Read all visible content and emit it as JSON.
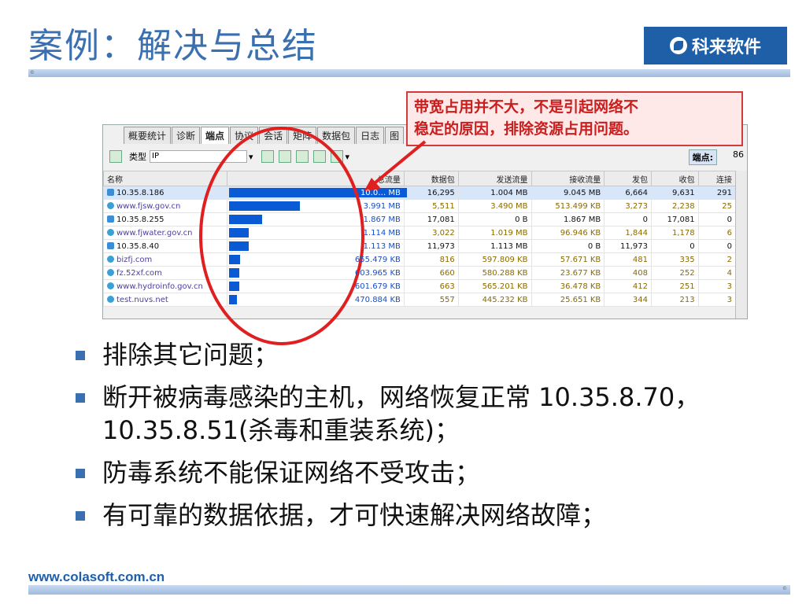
{
  "slide": {
    "title": "案例：解决与总结",
    "logo_text": "科来软件",
    "footer_url": "www.colasoft.com.cn"
  },
  "app": {
    "tabs": [
      "概要统计",
      "诊断",
      "端点",
      "协议",
      "会话",
      "矩阵",
      "数据包",
      "日志",
      "图"
    ],
    "active_tab": "端点",
    "toolbar": {
      "type_label": "类型",
      "type_value": "IP"
    },
    "endpoint_label": "端点:",
    "endpoint_value": "86",
    "columns": [
      "名称",
      "总流量",
      "数据包",
      "发送流量",
      "接收流量",
      "发包",
      "收包",
      "连接"
    ],
    "rows": [
      {
        "name": "10.35.8.186",
        "kind": "host",
        "total": "10.0… MB",
        "bar": 1.0,
        "packets": "16,295",
        "sent": "1.004 MB",
        "recv": "9.045 MB",
        "txp": "6,664",
        "rxp": "9,631",
        "conn": "291",
        "selected": true
      },
      {
        "name": "www.fjsw.gov.cn",
        "kind": "web",
        "total": "3.991 MB",
        "bar": 0.397,
        "packets": "5,511",
        "sent": "3.490 MB",
        "recv": "513.499 KB",
        "txp": "3,273",
        "rxp": "2,238",
        "conn": "25"
      },
      {
        "name": "10.35.8.255",
        "kind": "host",
        "total": "1.867 MB",
        "bar": 0.186,
        "packets": "17,081",
        "sent": "0 B",
        "recv": "1.867 MB",
        "txp": "0",
        "rxp": "17,081",
        "conn": "0"
      },
      {
        "name": "www.fjwater.gov.cn",
        "kind": "web",
        "total": "1.114 MB",
        "bar": 0.111,
        "packets": "3,022",
        "sent": "1.019 MB",
        "recv": "96.946 KB",
        "txp": "1,844",
        "rxp": "1,178",
        "conn": "6"
      },
      {
        "name": "10.35.8.40",
        "kind": "host",
        "total": "1.113 MB",
        "bar": 0.111,
        "packets": "11,973",
        "sent": "1.113 MB",
        "recv": "0 B",
        "txp": "11,973",
        "rxp": "0",
        "conn": "0"
      },
      {
        "name": "bizfj.com",
        "kind": "web",
        "total": "655.479 KB",
        "bar": 0.064,
        "packets": "816",
        "sent": "597.809 KB",
        "recv": "57.671 KB",
        "txp": "481",
        "rxp": "335",
        "conn": "2"
      },
      {
        "name": "fz.52xf.com",
        "kind": "web",
        "total": "603.965 KB",
        "bar": 0.059,
        "packets": "660",
        "sent": "580.288 KB",
        "recv": "23.677 KB",
        "txp": "408",
        "rxp": "252",
        "conn": "4"
      },
      {
        "name": "www.hydroinfo.gov.cn",
        "kind": "web",
        "total": "601.679 KB",
        "bar": 0.059,
        "packets": "663",
        "sent": "565.201 KB",
        "recv": "36.478 KB",
        "txp": "412",
        "rxp": "251",
        "conn": "3"
      },
      {
        "name": "test.nuvs.net",
        "kind": "web",
        "total": "470.884 KB",
        "bar": 0.046,
        "packets": "557",
        "sent": "445.232 KB",
        "recv": "25.651 KB",
        "txp": "344",
        "rxp": "213",
        "conn": "3"
      }
    ]
  },
  "callout": {
    "line1": "带宽占用并不大，不是引起网络不",
    "line2": "稳定的原因，排除资源占用问题。"
  },
  "bullets": [
    "排除其它问题；",
    "断开被病毒感染的主机，网络恢复正常 10.35.8.70，10.35.8.51(杀毒和重装系统)；",
    "防毒系统不能保证网络不受攻击；",
    "有可靠的数据依据，才可快速解决网络故障；"
  ],
  "colors": {
    "accent": "#3a6fb0",
    "bar": "#0a5ad6",
    "alert": "#d23b3b"
  }
}
